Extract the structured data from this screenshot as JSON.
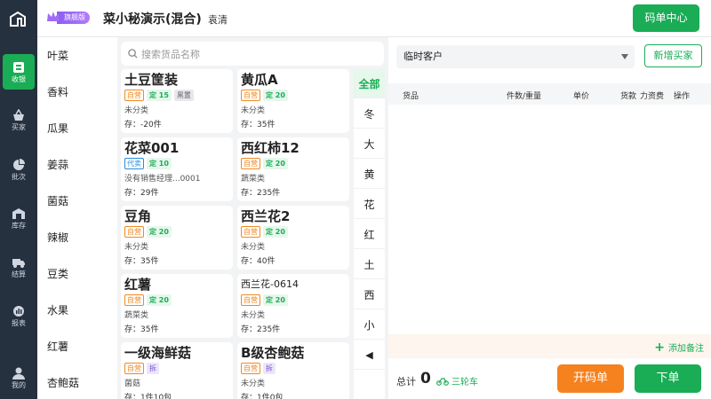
{
  "header": {
    "badge": "旗舰版",
    "shop_name": "菜小秘演示(混合)",
    "user_name": "袁清",
    "code_center": "码单中心"
  },
  "nav": [
    {
      "label": "收银",
      "icon": "cashier-icon",
      "active": true
    },
    {
      "label": "买家",
      "icon": "basket-icon"
    },
    {
      "label": "批次",
      "icon": "pie-chart-icon"
    },
    {
      "label": "库存",
      "icon": "warehouse-icon"
    },
    {
      "label": "结算",
      "icon": "truck-icon"
    },
    {
      "label": "报表",
      "icon": "report-icon"
    },
    {
      "label": "我的",
      "icon": "user-icon"
    }
  ],
  "categories": [
    "叶菜",
    "香料",
    "瓜果",
    "姜蒜",
    "菌菇",
    "辣椒",
    "豆类",
    "水果",
    "红薯",
    "杏鲍菇"
  ],
  "search": {
    "placeholder": "搜索货品名称"
  },
  "goods": [
    {
      "name": "土豆筐装",
      "tags": [
        "自营",
        "定 15",
        "黑置"
      ],
      "category": "未分类",
      "stock": "存：-20件"
    },
    {
      "name": "黄瓜A",
      "tags": [
        "自营",
        "定 20"
      ],
      "category": "未分类",
      "stock": "存：35件"
    },
    {
      "name": "花菜001",
      "tags": [
        "代卖",
        "定 10"
      ],
      "category": "没有销售经理...0001",
      "stock": "存：29件"
    },
    {
      "name": "西红柿12",
      "tags": [
        "自营",
        "定 20"
      ],
      "category": "蔬菜类",
      "stock": "存：235件"
    },
    {
      "name": "豆角",
      "tags": [
        "自营",
        "定 20"
      ],
      "category": "未分类",
      "stock": "存：35件"
    },
    {
      "name": "西兰花2",
      "tags": [
        "自营",
        "定 20"
      ],
      "category": "未分类",
      "stock": "存：40件"
    },
    {
      "name": "红薯",
      "tags": [
        "自营",
        "定 20"
      ],
      "category": "蔬菜类",
      "stock": "存：35件"
    },
    {
      "name": "西兰花-0614",
      "tags": [
        "自营",
        "定 20"
      ],
      "category": "未分类",
      "stock": "存：235件"
    },
    {
      "name": "一级海鲜菇",
      "tags": [
        "自营",
        "拆"
      ],
      "category": "菌菇",
      "stock": "存：1件10包"
    },
    {
      "name": "B级杏鲍菇",
      "tags": [
        "自营",
        "拆"
      ],
      "category": "未分类",
      "stock": "存：1件0包"
    }
  ],
  "letters": [
    "全部",
    "冬",
    "大",
    "黄",
    "花",
    "红",
    "土",
    "西",
    "小",
    "◀"
  ],
  "order": {
    "customer": "临时客户",
    "new_buyer": "新增买家",
    "columns": [
      "货品",
      "件数/重量",
      "单价",
      "货款",
      "力资费",
      "操作"
    ],
    "add_note": "添加备注",
    "total_label": "总计",
    "total_value": "0",
    "vehicle": "三轮车",
    "code_button": "开码单",
    "order_button": "下单"
  }
}
